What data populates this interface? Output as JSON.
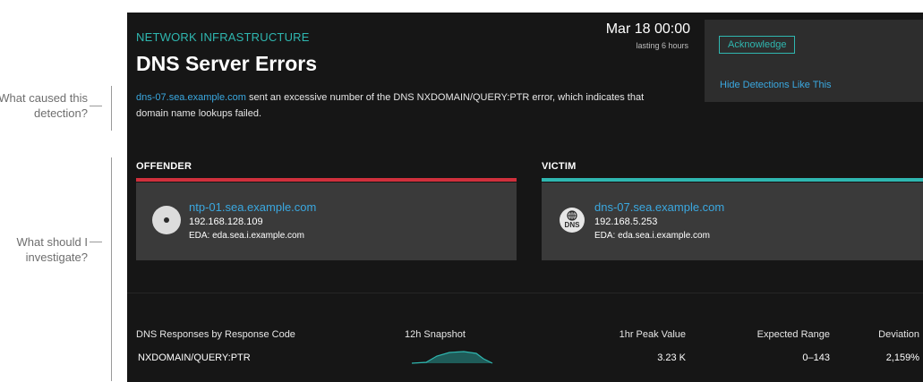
{
  "annotations": [
    {
      "text": "What caused this detection?"
    },
    {
      "text": "What should I investigate?"
    }
  ],
  "detection": {
    "category": "NETWORK INFRASTRUCTURE",
    "title": "DNS Server Errors",
    "date": "Mar 18 00:00",
    "duration": "lasting 6 hours",
    "description_link": "dns-07.sea.example.com",
    "description_line1": " sent an excessive number of the DNS NXDOMAIN/QUERY:PTR error, which indicates that",
    "description_line2": "domain name lookups failed."
  },
  "actions": {
    "acknowledge_label": "Acknowledge",
    "hide_label": "Hide Detections Like This"
  },
  "offender": {
    "role": "OFFENDER",
    "host": "ntp-01.sea.example.com",
    "ip": "192.168.128.109",
    "eda": "EDA: eda.sea.i.example.com",
    "icon": "device-icon",
    "color": "#d0303c"
  },
  "victim": {
    "role": "VICTIM",
    "host": "dns-07.sea.example.com",
    "ip": "192.168.5.253",
    "eda": "EDA: eda.sea.i.example.com",
    "icon": "dns-server-icon",
    "icon_text": "DNS",
    "color": "#2fb7b0"
  },
  "metrics": {
    "headers": {
      "name": "DNS Responses by Response Code",
      "snapshot": "12h Snapshot",
      "peak": "1hr Peak Value",
      "range": "Expected Range",
      "deviation": "Deviation"
    },
    "row": {
      "name": "NXDOMAIN/QUERY:PTR",
      "peak": "3.23 K",
      "range": "0–143",
      "deviation": "2,159%"
    }
  },
  "colors": {
    "accent_teal": "#2fb7b0",
    "link_blue": "#3aa8e0",
    "panel_bg": "#161616",
    "card_bg": "#3a3a3a"
  }
}
